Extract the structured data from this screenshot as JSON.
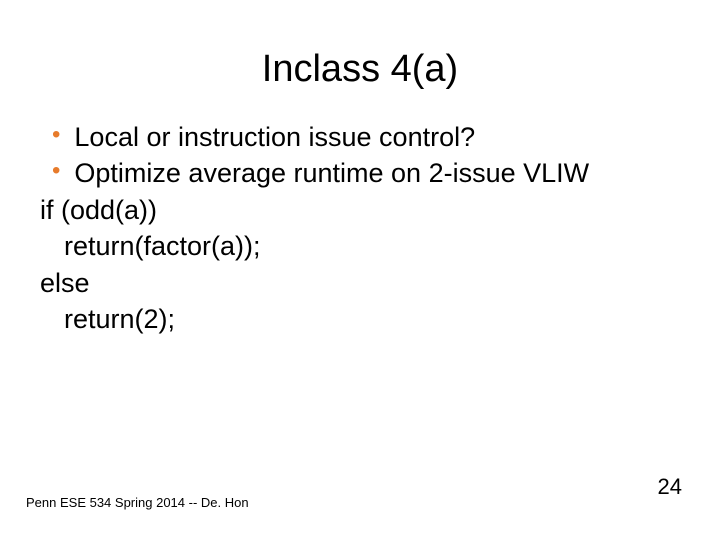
{
  "title": "Inclass 4(a)",
  "bullets": [
    "Local or instruction issue control?",
    "Optimize average runtime on 2-issue VLIW"
  ],
  "code": {
    "line1": "if (odd(a))",
    "line2": "return(factor(a));",
    "line3": "else",
    "line4": "return(2);"
  },
  "footer": "Penn ESE 534 Spring 2014 -- De. Hon",
  "page_number": "24"
}
